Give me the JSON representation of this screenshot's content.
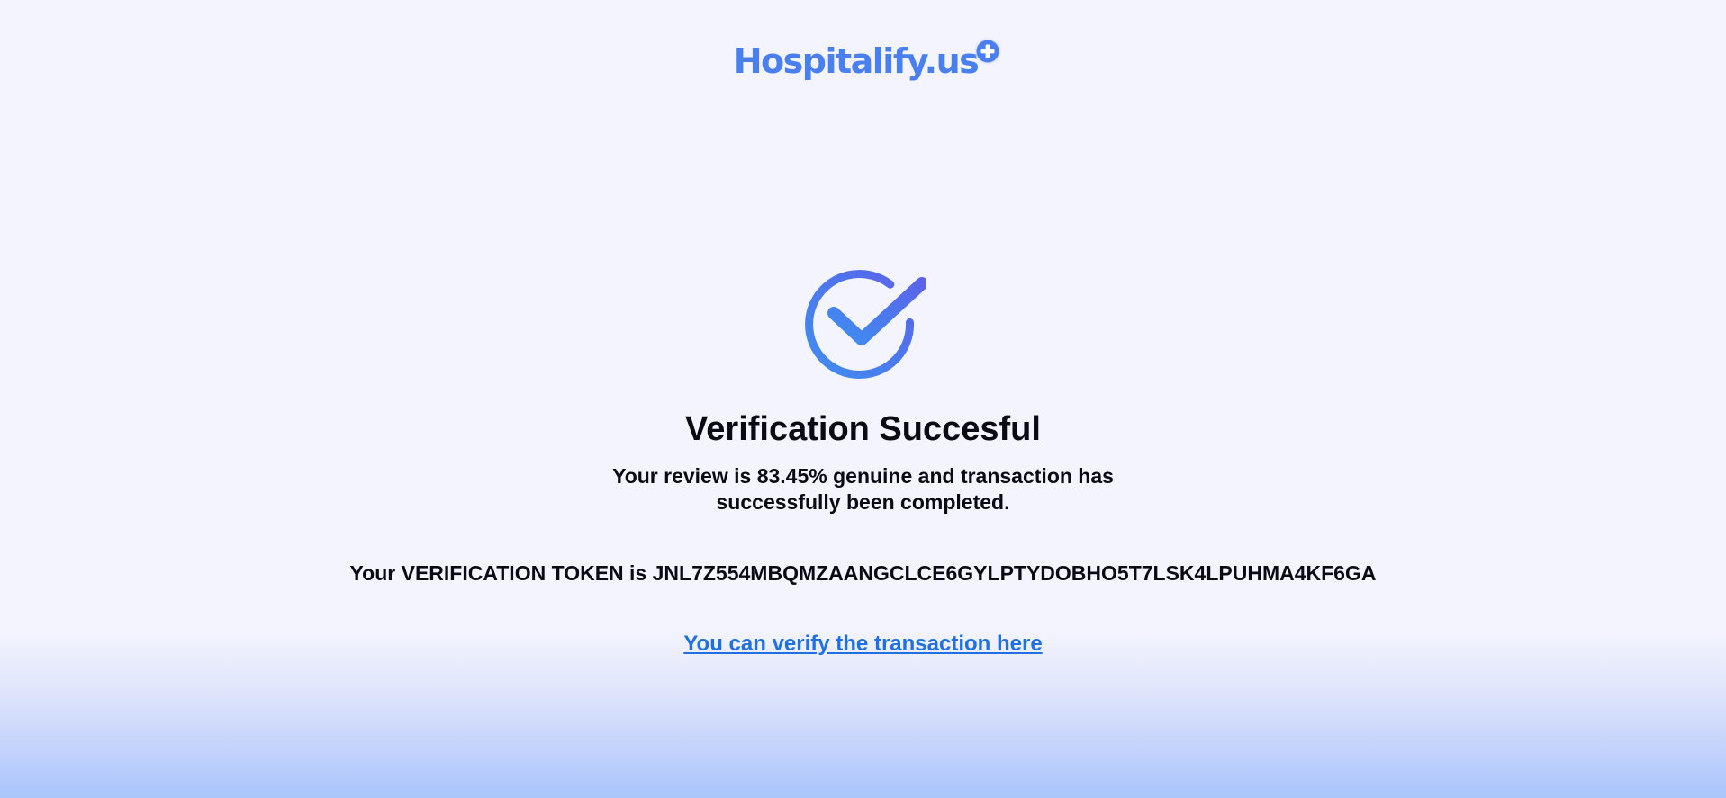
{
  "brand": {
    "name": "Hospitalify.us",
    "logo_icon": "plus-badge-icon",
    "color": "#4a7ff0"
  },
  "status": {
    "icon": "check-circle-icon",
    "title": "Verification Succesful",
    "message": "Your review is 83.45% genuine and transaction has successfully been completed."
  },
  "token": {
    "text": "Your VERIFICATION TOKEN is JNL7Z554MBQMZAANGCLCE6GYLPTYDOBHO5T7LSK4LPUHMA4KF6GA"
  },
  "link": {
    "label": "You can verify the transaction here",
    "color": "#1f6fe5"
  },
  "colors": {
    "background": "#f3f4fd",
    "gradient_bottom": "#aac5fc",
    "check_gradient_start": "#3f8ef0",
    "check_gradient_end": "#5a63ea"
  }
}
